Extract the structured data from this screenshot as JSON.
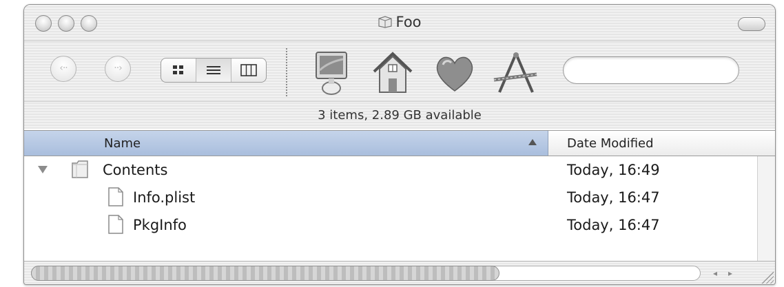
{
  "window": {
    "title": "Foo",
    "buttons": [
      "close",
      "minimize",
      "zoom"
    ]
  },
  "toolbar": {
    "back_glyph": "‹··",
    "forward_glyph": "··›",
    "view_modes": [
      "icon-view",
      "list-view",
      "column-view"
    ],
    "active_view": "list-view",
    "places": [
      "computer-icon",
      "home-icon",
      "favorites-icon",
      "applications-icon"
    ],
    "search": {
      "value": "",
      "placeholder": ""
    }
  },
  "status": {
    "text": "3 items, 2.89 GB available"
  },
  "columns": {
    "name": "Name",
    "date": "Date Modified"
  },
  "rows": [
    {
      "name": "Contents",
      "date": "Today, 16:49",
      "kind": "folder",
      "expanded": true
    },
    {
      "name": "Info.plist",
      "date": "Today, 16:47",
      "kind": "document"
    },
    {
      "name": "PkgInfo",
      "date": "Today, 16:47",
      "kind": "document"
    }
  ],
  "scrollbar": {
    "left_arrow": "◂",
    "right_arrow": "▸"
  }
}
